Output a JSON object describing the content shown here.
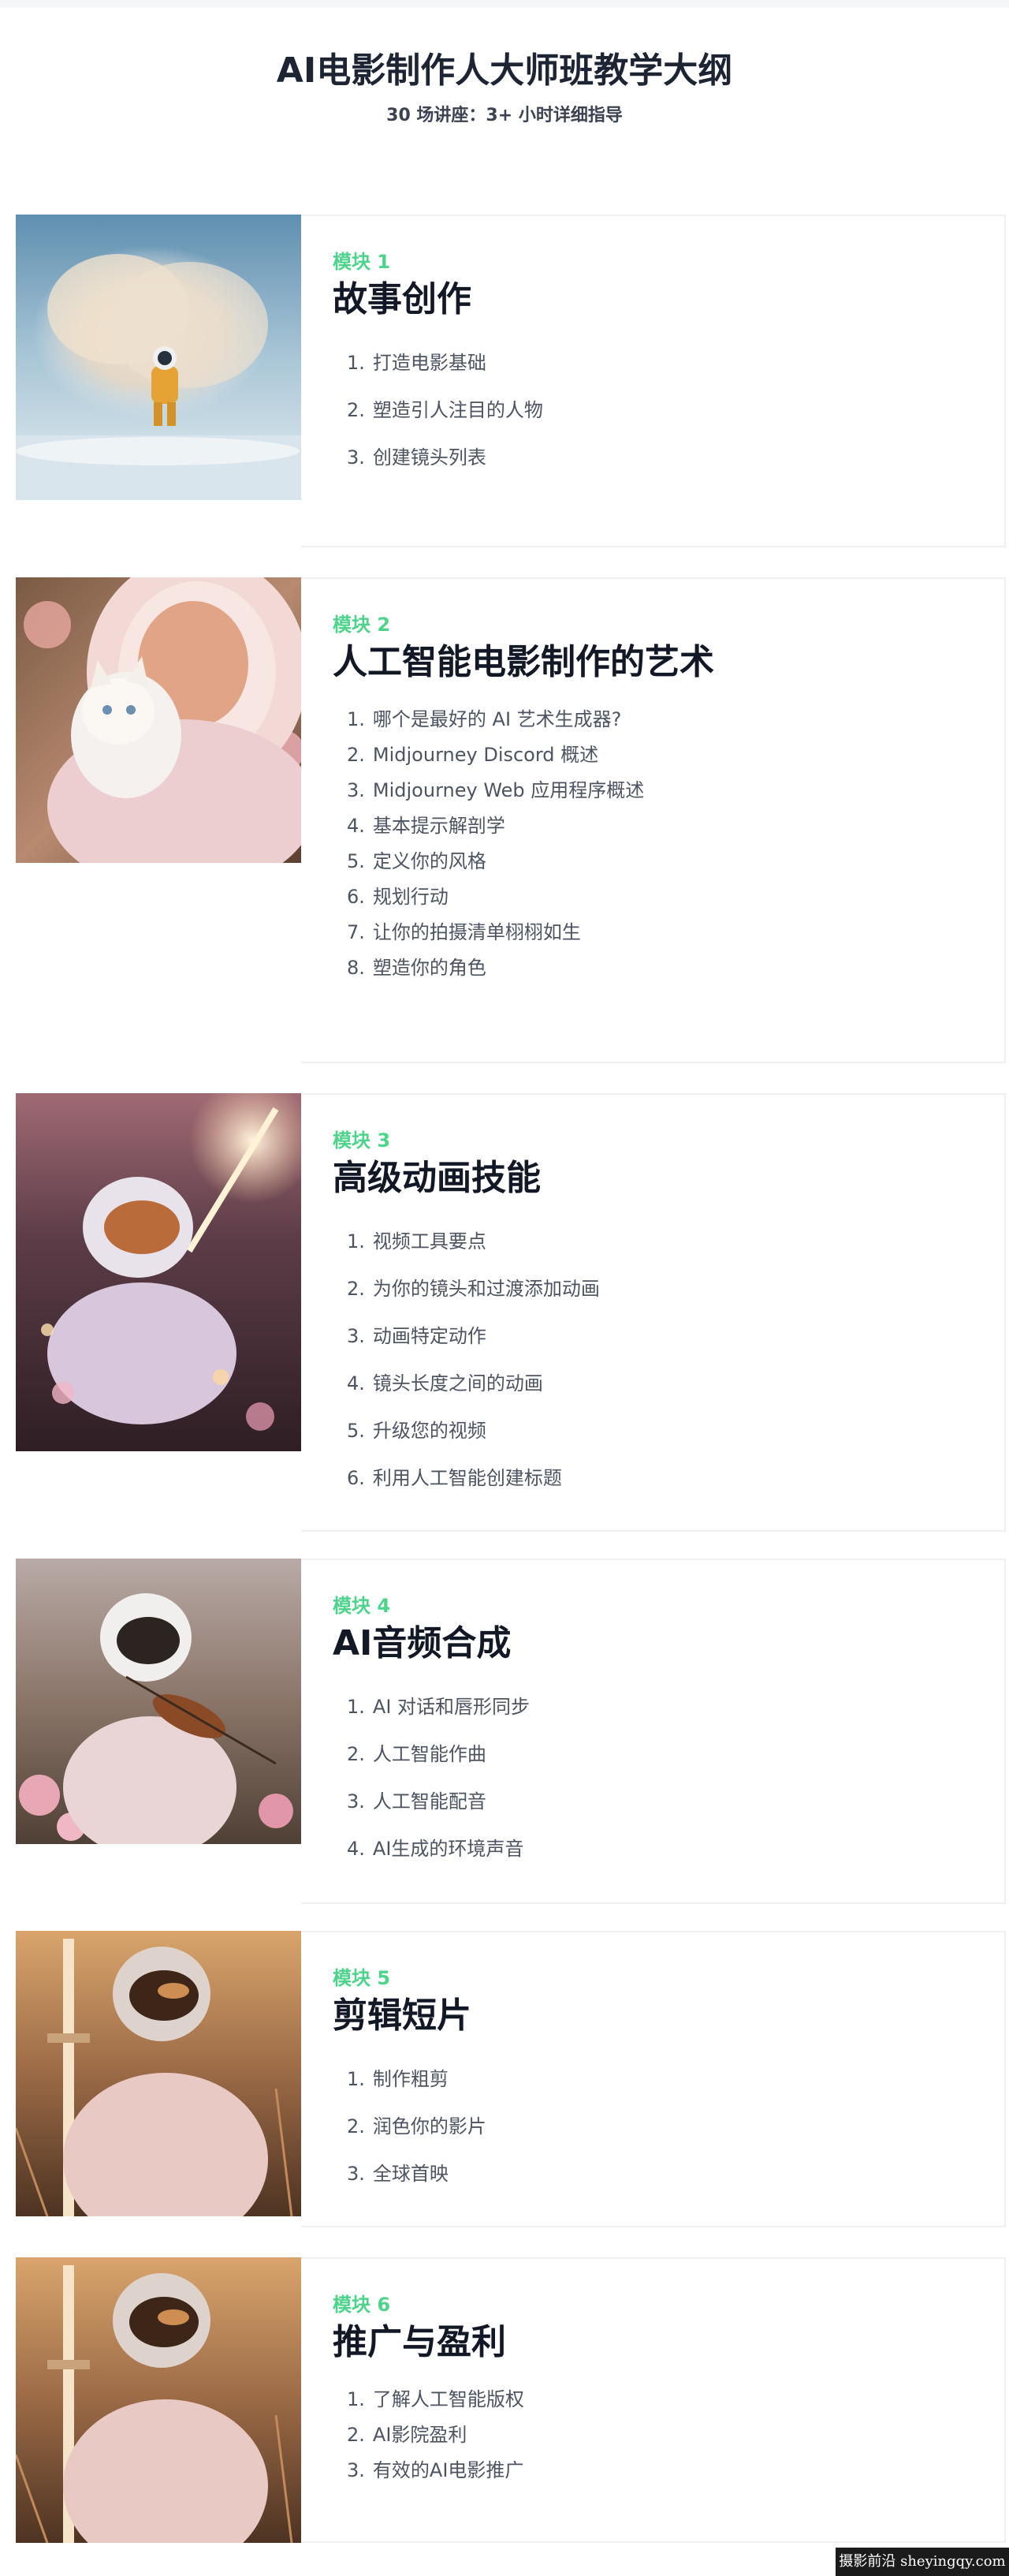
{
  "header": {
    "title": "AI电影制作人大师班教学大纲",
    "subtitle": "30 场讲座：3+ 小时详细指导"
  },
  "colors": {
    "module_label": "#4cd58a",
    "heading": "#121826",
    "lesson_text": "#4c5461",
    "card_border": "#eef0f2"
  },
  "modules": [
    {
      "label": "模块 1",
      "title": "故事创作",
      "image": "astronaut-walking-in-clouds",
      "lessons": [
        {
          "num": "1.",
          "text": "打造电影基础"
        },
        {
          "num": "2.",
          "text": "塑造引人注目的人物"
        },
        {
          "num": "3.",
          "text": "创建镜头列表"
        }
      ]
    },
    {
      "label": "模块 2",
      "title": "人工智能电影制作的艺术",
      "image": "astronaut-holding-kitten",
      "lessons": [
        {
          "num": "1.",
          "text": "哪个是最好的 AI 艺术生成器?"
        },
        {
          "num": "2.",
          "text": "Midjourney Discord 概述"
        },
        {
          "num": "3.",
          "text": "Midjourney Web 应用程序概述"
        },
        {
          "num": "4.",
          "text": "基本提示解剖学"
        },
        {
          "num": "5.",
          "text": "定义你的风格"
        },
        {
          "num": "6.",
          "text": "规划行动"
        },
        {
          "num": "7.",
          "text": "让你的拍摄清单栩栩如生"
        },
        {
          "num": "8.",
          "text": "塑造你的角色"
        }
      ]
    },
    {
      "label": "模块 3",
      "title": "高级动画技能",
      "image": "astronaut-with-light-sword-in-flowers",
      "lessons": [
        {
          "num": "1.",
          "text": "视频工具要点"
        },
        {
          "num": "2.",
          "text": "为你的镜头和过渡添加动画"
        },
        {
          "num": "3.",
          "text": "动画特定动作"
        },
        {
          "num": "4.",
          "text": "镜头长度之间的动画"
        },
        {
          "num": "5.",
          "text": "升级您的视频"
        },
        {
          "num": "6.",
          "text": "利用人工智能创建标题"
        }
      ]
    },
    {
      "label": "模块 4",
      "title": "AI音频合成",
      "image": "astronaut-playing-violin",
      "lessons": [
        {
          "num": "1.",
          "text": "AI 对话和唇形同步"
        },
        {
          "num": "2.",
          "text": "人工智能作曲"
        },
        {
          "num": "3.",
          "text": "人工智能配音"
        },
        {
          "num": "4.",
          "text": "AI生成的环境声音"
        }
      ]
    },
    {
      "label": "模块 5",
      "title": "剪辑短片",
      "image": "astronaut-with-sword-sunset",
      "lessons": [
        {
          "num": "1.",
          "text": "制作粗剪"
        },
        {
          "num": "2.",
          "text": "润色你的影片"
        },
        {
          "num": "3.",
          "text": "全球首映"
        }
      ]
    },
    {
      "label": "模块 6",
      "title": "推广与盈利",
      "image": "astronaut-with-sword-sunset",
      "lessons": [
        {
          "num": "1.",
          "text": "了解人工智能版权"
        },
        {
          "num": "2.",
          "text": "AI影院盈利"
        },
        {
          "num": "3.",
          "text": "有效的AI电影推广"
        }
      ]
    }
  ],
  "watermark": "摄影前沿 sheyingqy.com"
}
